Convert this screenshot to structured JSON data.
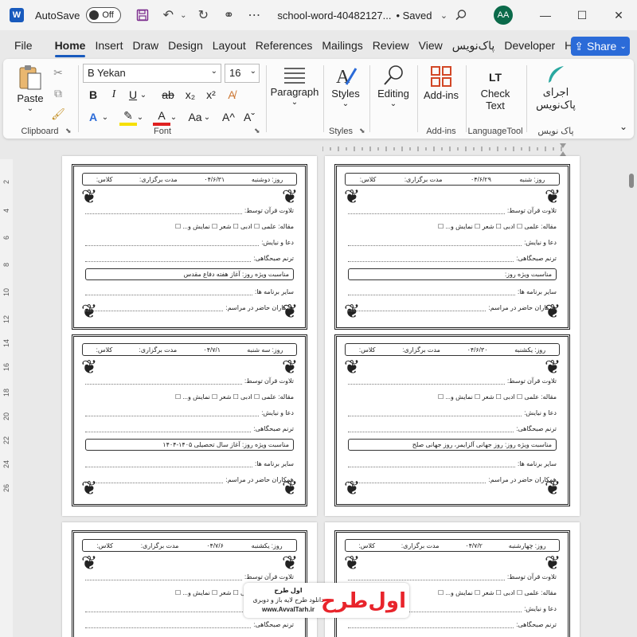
{
  "titlebar": {
    "app_logo": "W",
    "autosave_label": "AutoSave",
    "autosave_state": "Off",
    "doc_title": "school-word-40482127...",
    "saved_status": "• Saved",
    "avatar_initials": "AA"
  },
  "tabs": [
    "File",
    "Home",
    "Insert",
    "Draw",
    "Design",
    "Layout",
    "References",
    "Mailings",
    "Review",
    "View",
    "پاک‌نویس",
    "Developer",
    "Help"
  ],
  "active_tab": "Home",
  "share_label": "Share",
  "ribbon": {
    "clipboard": {
      "paste": "Paste",
      "group": "Clipboard"
    },
    "font": {
      "family": "B Yekan",
      "size": "16",
      "group": "Font",
      "change_case": "Aa"
    },
    "paragraph": {
      "label": "Paragraph"
    },
    "styles": {
      "label": "Styles",
      "group": "Styles"
    },
    "editing": {
      "label": "Editing"
    },
    "addins": {
      "label": "Add-ins",
      "group": "Add-ins"
    },
    "checktext": {
      "label1": "Check",
      "label2": "Text",
      "group": "LanguageTool",
      "logo": "LT"
    },
    "paknevis": {
      "label1": "اجرای",
      "label2": "پاک‌نویس",
      "group": "پاک نویس"
    }
  },
  "vruler_numbers": [
    "2",
    "4",
    "6",
    "8",
    "10",
    "12",
    "14",
    "16",
    "18",
    "20",
    "22",
    "24",
    "26"
  ],
  "form": {
    "day_label": "روز:",
    "class_label": "کلاس:",
    "duration_label": "مدت برگزاری:",
    "quran": "تلاوت قرآن توسط:",
    "article": "مقاله: علمی ☐ ادبی ☐ شعر ☐ نمایش و... ☐",
    "prayer": "دعا و نیایش:",
    "anthem": "ترنم صبحگاهی:",
    "occasion": "مناسبت ویژه روز:",
    "other": "سایر برنامه ها:",
    "colleagues": "همکاران حاضر در مراسم:"
  },
  "cards": [
    {
      "day": "دوشنبه",
      "date": "۰۴/۶/۳۱",
      "occasion_text": "آغاز هفته دفاع مقدس"
    },
    {
      "day": "شنبه",
      "date": "۰۴/۶/۲۹",
      "occasion_text": ""
    },
    {
      "day": "سه شنبه",
      "date": "۰۴/۷/۱",
      "occasion_text": "آغاز سال تحصیلی ۱۴۰۵-۱۴۰۴"
    },
    {
      "day": "یکشنبه",
      "date": "۰۴/۶/۳۰",
      "occasion_text": "روز جهانی آلزایمر، روز جهانی صلح"
    },
    {
      "day": "یکشنبه",
      "date": "۰۴/۷/۶",
      "occasion_text": ""
    },
    {
      "day": "چهارشنبه",
      "date": "۰۴/۷/۲",
      "occasion_text": ""
    }
  ],
  "watermark": {
    "line1": "اول طرح",
    "line2": "دانلود طرح لایه باز و دوبری",
    "line3": "www.AvvalTarh.ir",
    "logo_text": "اول‌طرح"
  }
}
